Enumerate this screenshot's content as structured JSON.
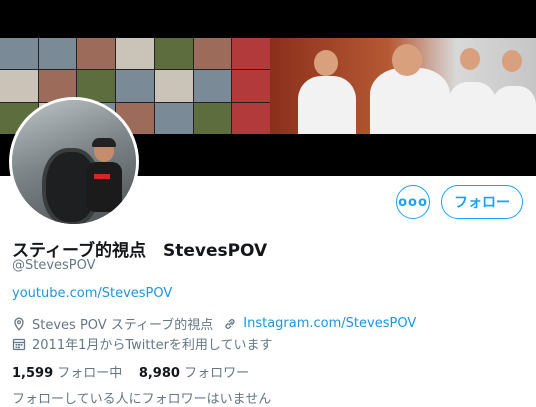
{
  "profile": {
    "display_name": "スティーブ的視点　StevesPOV",
    "handle": "@StevesPOV",
    "bio_link": "youtube.com/StevesPOV",
    "location": "Steves POV スティーブ的視点",
    "website": "Instagram.com/StevesPOV",
    "joined": "2011年1月からTwitterを利用しています"
  },
  "buttons": {
    "more_label": "ooo",
    "follow_label": "フォロー"
  },
  "stats": {
    "following_count": "1,599",
    "following_label": "フォロー中",
    "followers_count": "8,980",
    "followers_label": "フォロワー"
  },
  "note": "フォローしている人にフォロワーはいません",
  "colors": {
    "accent": "#1da1f2",
    "link": "#1b95e0",
    "secondary_text": "#657786"
  },
  "icons": [
    "location-icon",
    "link-icon",
    "calendar-icon"
  ]
}
